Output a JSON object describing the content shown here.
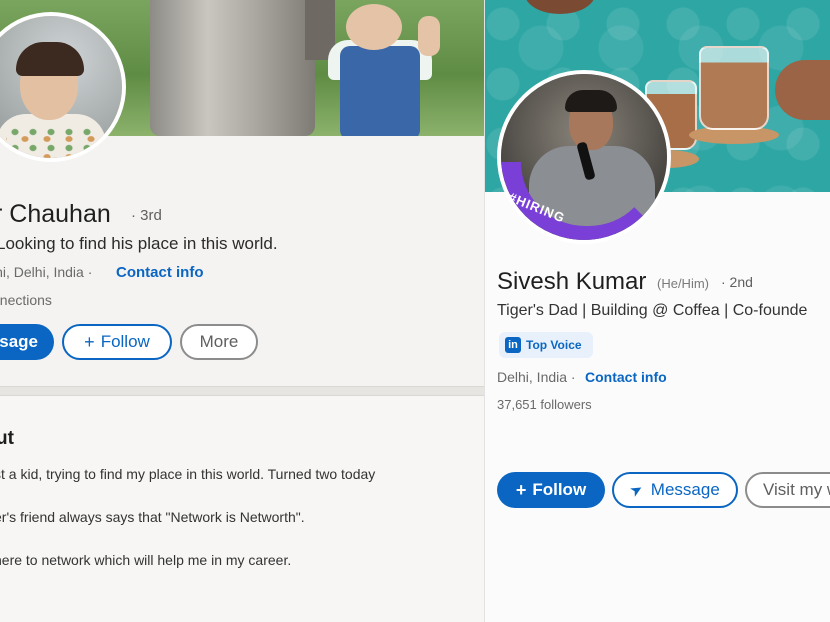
{
  "left_profile": {
    "name": "r Chauhan",
    "degree": "· 3rd",
    "headline": "Looking to find his place in this world.",
    "location": "lhi, Delhi, India ·",
    "contact_info": "Contact info",
    "connections": "nnections",
    "buttons": {
      "message": "sage",
      "follow": "Follow",
      "more": "More"
    },
    "about": {
      "title": "ut",
      "lines": [
        "st a kid, trying to find my place in this world. Turned two today",
        "er's friend always says that \"Network is Networth\".",
        " here to network which will help me in my career."
      ]
    }
  },
  "right_profile": {
    "name": "Sivesh Kumar",
    "pronouns": "(He/Him)",
    "degree": "· 2nd",
    "headline": "Tiger's Dad | Building @ Coffea | Co-founde",
    "badge": {
      "logo": "in",
      "label": "Top Voice"
    },
    "hiring_frame": "#HIRING",
    "location": "Delhi, India ·",
    "contact_info": "Contact info",
    "followers": "37,651 followers",
    "buttons": {
      "follow": "Follow",
      "message": "Message",
      "visit": "Visit my w"
    }
  },
  "icons": {
    "follow": "plus-icon",
    "message": "send-icon"
  },
  "colors": {
    "linkedin_blue": "#0a66c2",
    "hiring_purple": "#7a3fd6",
    "banner_teal": "#2ea6a4"
  }
}
